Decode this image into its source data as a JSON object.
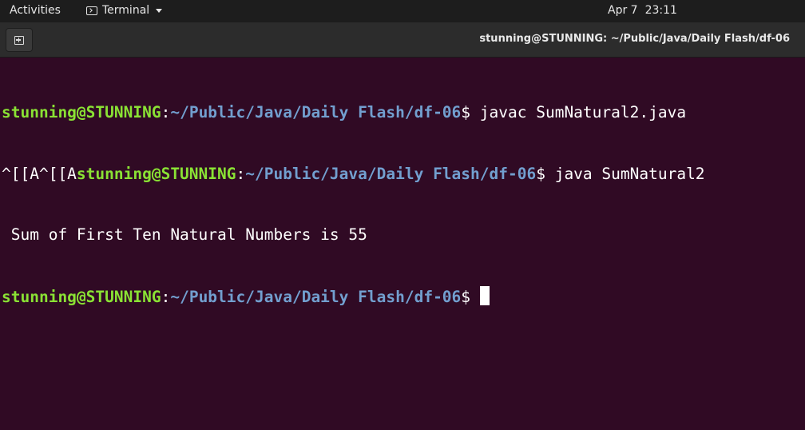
{
  "topbar": {
    "activities": "Activities",
    "app_name": "Terminal",
    "date": "Apr 7",
    "time": "23:11"
  },
  "window": {
    "title": "stunning@STUNNING: ~/Public/Java/Daily Flash/df-06"
  },
  "terminal": {
    "user_host": "stunning@STUNNING",
    "colon": ":",
    "cwd": "~/Public/Java/Daily Flash/df-06",
    "prompt_symbol": "$ ",
    "line1_command": "javac SumNatural2.java",
    "line2_prefix": "^[[A^[[A",
    "line2_command": "java SumNatural2",
    "output": " Sum of First Ten Natural Numbers is 55"
  },
  "colors": {
    "background": "#300a24",
    "user_green": "#8ae234",
    "path_blue": "#729fcf"
  },
  "icons": [
    "terminal-icon",
    "dropdown-caret-icon",
    "new-tab-icon"
  ]
}
